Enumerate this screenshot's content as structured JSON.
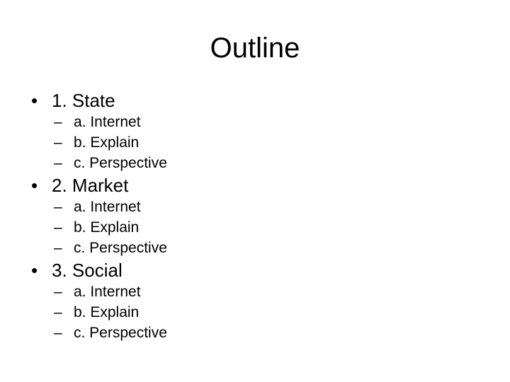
{
  "slide": {
    "title": "Outline",
    "bullet_glyph": "•",
    "dash_glyph": "–",
    "sections": [
      {
        "label": "1. State",
        "items": [
          "a. Internet",
          "b. Explain",
          "c. Perspective"
        ]
      },
      {
        "label": "2. Market",
        "items": [
          "a. Internet",
          "b. Explain",
          "c. Perspective"
        ]
      },
      {
        "label": "3. Social",
        "items": [
          "a. Internet",
          "b. Explain",
          "c. Perspective"
        ]
      }
    ]
  }
}
